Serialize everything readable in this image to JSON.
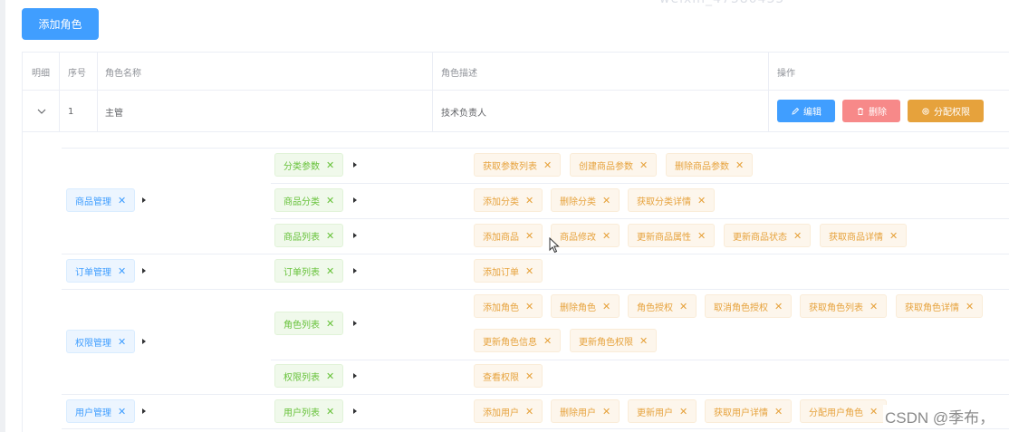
{
  "watermark_top": "weixin_47580435",
  "add_role_button": "添加角色",
  "table": {
    "headers": {
      "expand": "明细",
      "index": "序号",
      "name": "角色名称",
      "desc": "角色描述",
      "ops": "操作"
    },
    "row": {
      "index": "1",
      "name": "主管",
      "desc": "技术负责人",
      "edit": "编辑",
      "delete": "删除",
      "assign": "分配权限"
    }
  },
  "rights": {
    "l1": [
      "商品管理",
      "订单管理",
      "权限管理",
      "用户管理"
    ],
    "l2": [
      "分类参数",
      "商品分类",
      "商品列表",
      "订单列表",
      "角色列表",
      "权限列表",
      "用户列表"
    ],
    "l3": {
      "cat_params": [
        "获取参数列表",
        "创建商品参数",
        "删除商品参数"
      ],
      "goods_cat": [
        "添加分类",
        "删除分类",
        "获取分类详情"
      ],
      "goods_list": [
        "添加商品",
        "商品修改",
        "更新商品属性",
        "更新商品状态",
        "获取商品详情"
      ],
      "order_list": [
        "添加订单"
      ],
      "role_list": [
        "添加角色",
        "删除角色",
        "角色授权",
        "取消角色授权",
        "获取角色列表",
        "获取角色详情",
        "更新角色信息",
        "更新角色权限"
      ],
      "right_list": [
        "查看权限"
      ],
      "user_list": [
        "添加用户",
        "删除用户",
        "更新用户",
        "获取用户详情",
        "分配用户角色"
      ]
    }
  },
  "close_glyph": "✕",
  "watermark_csdn": "CSDN @季布，",
  "colors": {
    "primary": "#409eff",
    "danger": "#f78989",
    "warning": "#e6a23c",
    "success": "#67c23a"
  },
  "icons": [
    "expand-arrow-icon",
    "edit-icon",
    "delete-icon",
    "settings-icon",
    "caret-right-icon",
    "close-icon",
    "mouse-cursor-icon"
  ]
}
